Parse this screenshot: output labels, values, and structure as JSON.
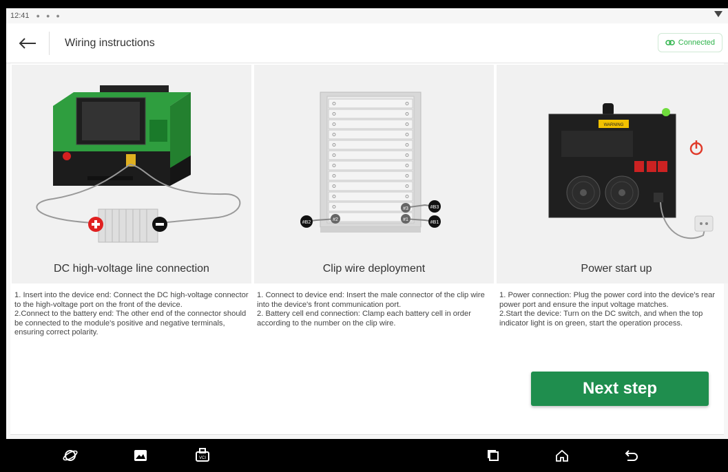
{
  "status_bar": {
    "time": "12:41"
  },
  "header": {
    "title": "Wiring instructions",
    "connected_label": "Connected"
  },
  "cards": [
    {
      "caption": "DC high-voltage line connection",
      "description": "1. Insert into the device end: Connect the DC high-voltage connector to the high-voltage port on the front of the device.\n2.Connect to the battery end: The other end of the connector should be connected to the module's positive and negative terminals, ensuring correct polarity."
    },
    {
      "caption": "Clip wire deployment",
      "description": "1. Connect to device end: Insert the male connector of the clip wire into the device's front communication port.\n2. Battery cell end connection: Clamp each battery cell in order according to the number on the clip wire.",
      "labels": [
        "#B2",
        "#2",
        "#3",
        "#B3",
        "#1",
        "#B1"
      ]
    },
    {
      "caption": "Power start up",
      "description": "1. Power connection: Plug the power cord into the device's rear power port and ensure the input voltage matches.\n2.Start the device: Turn on the DC switch, and when the top indicator light is on green, start the operation process.",
      "warning_label": "WARNING"
    }
  ],
  "actions": {
    "next_label": "Next step"
  },
  "colors": {
    "accent": "#1f8e4e",
    "connected": "#2db34a",
    "device_green": "#2f9e3f"
  },
  "nav_bar": {
    "icons": [
      "browser-icon",
      "gallery-icon",
      "vci-icon",
      "recents-icon",
      "home-icon",
      "back-nav-icon"
    ],
    "vci_label": "VCI"
  }
}
